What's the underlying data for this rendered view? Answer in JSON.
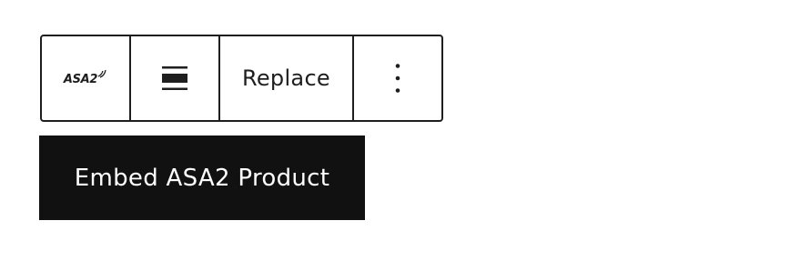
{
  "toolbar": {
    "logo": {
      "text": "ASA2",
      "icon": "asa2-logo-icon"
    },
    "align": {
      "icon": "align-full-width-icon"
    },
    "replace_label": "Replace",
    "more": {
      "icon": "vertical-ellipsis-icon",
      "glyph": "⋮"
    }
  },
  "block_label": "Embed ASA2 Product",
  "colors": {
    "border": "#1e1e1e",
    "label_background": "#111111",
    "label_text": "#ffffff",
    "page_background": "#ffffff"
  }
}
